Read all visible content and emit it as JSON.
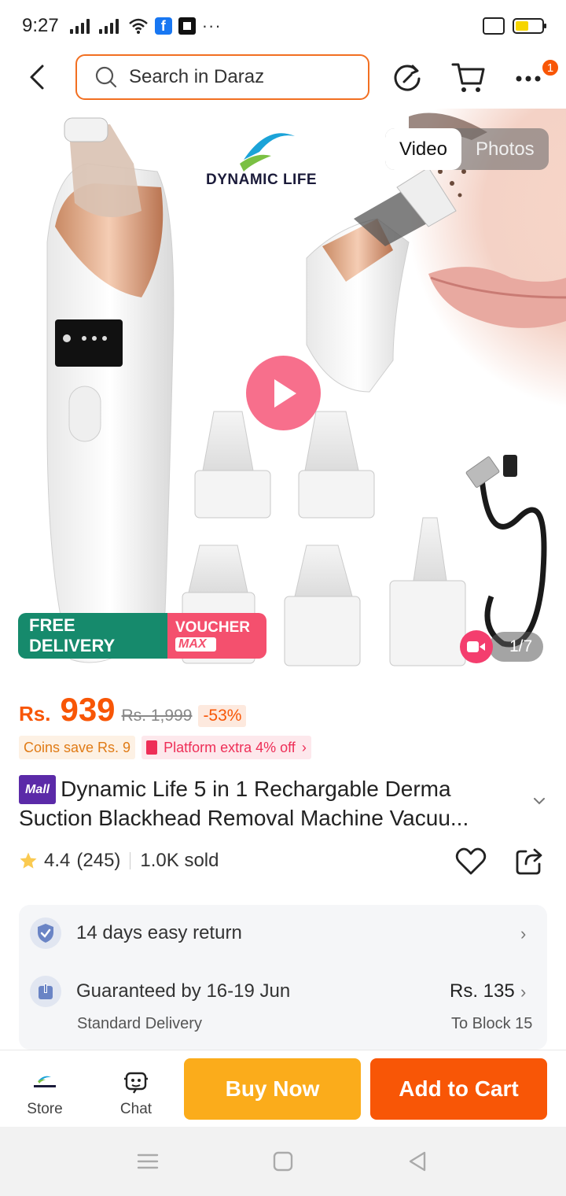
{
  "status_bar": {
    "time": "9:27",
    "dots": "···"
  },
  "header": {
    "search_placeholder": "Search in Daraz",
    "cart_badge_count": "1",
    "accent_color": "#f85606"
  },
  "gallery": {
    "tabs": [
      {
        "label": "Video",
        "active": true
      },
      {
        "label": "Photos",
        "active": false
      }
    ],
    "brand_text": "DYNAMIC LIFE",
    "free_delivery_label": "FREE DELIVERY",
    "voucher_label": "VOUCHER",
    "voucher_sub_label": "MAX",
    "counter": "1/7"
  },
  "price": {
    "currency": "Rs.",
    "current": "939",
    "original": "Rs. 1,999",
    "discount": "-53%"
  },
  "promos": {
    "coins": "Coins save Rs. 9",
    "platform": "Platform extra 4% off",
    "platform_chevron": "›"
  },
  "product": {
    "mall_tag": "Mall",
    "title": "Dynamic Life 5 in 1 Rechargable Derma Suction Blackhead Removal Machine Vacuu..."
  },
  "rating": {
    "score": "4.4",
    "count": "(245)",
    "sold": "1.0K sold"
  },
  "service": {
    "return_text": "14 days easy return",
    "delivery_text": "Guaranteed by 16-19 Jun",
    "delivery_type": "Standard Delivery",
    "delivery_fee": "Rs. 135",
    "delivery_dest": "To Block 15",
    "chevron": "›"
  },
  "bottom_bar": {
    "store_label": "Store",
    "chat_label": "Chat",
    "buy_now_label": "Buy Now",
    "add_to_cart_label": "Add to Cart"
  }
}
